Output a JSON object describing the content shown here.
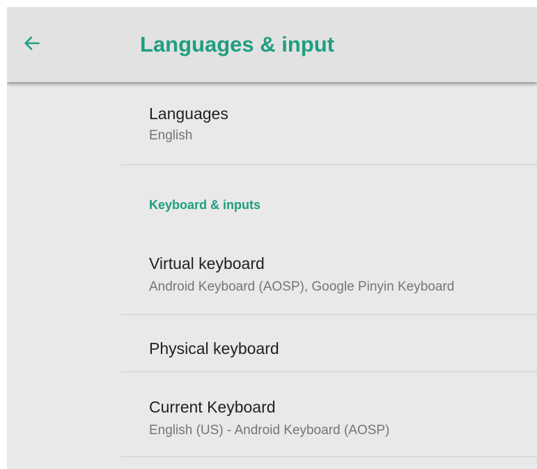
{
  "colors": {
    "accent": "#1f9e80",
    "title_text": "#212121",
    "summary_text": "#757575",
    "app_bar_bg": "#e2e2e2",
    "screen_bg": "#e9e9e9",
    "divider": "#cfcfcf"
  },
  "app_bar": {
    "back_icon": "arrow-left-icon",
    "title": "Languages & input"
  },
  "list": {
    "languages": {
      "title": "Languages",
      "summary": "English"
    },
    "category": {
      "title": "Keyboard & inputs"
    },
    "virtual_keyboard": {
      "title": "Virtual keyboard",
      "summary": "Android Keyboard (AOSP), Google Pinyin Keyboard"
    },
    "physical_keyboard": {
      "title": "Physical keyboard"
    },
    "current_keyboard": {
      "title": "Current Keyboard",
      "summary": "English (US) - Android Keyboard (AOSP)"
    }
  }
}
